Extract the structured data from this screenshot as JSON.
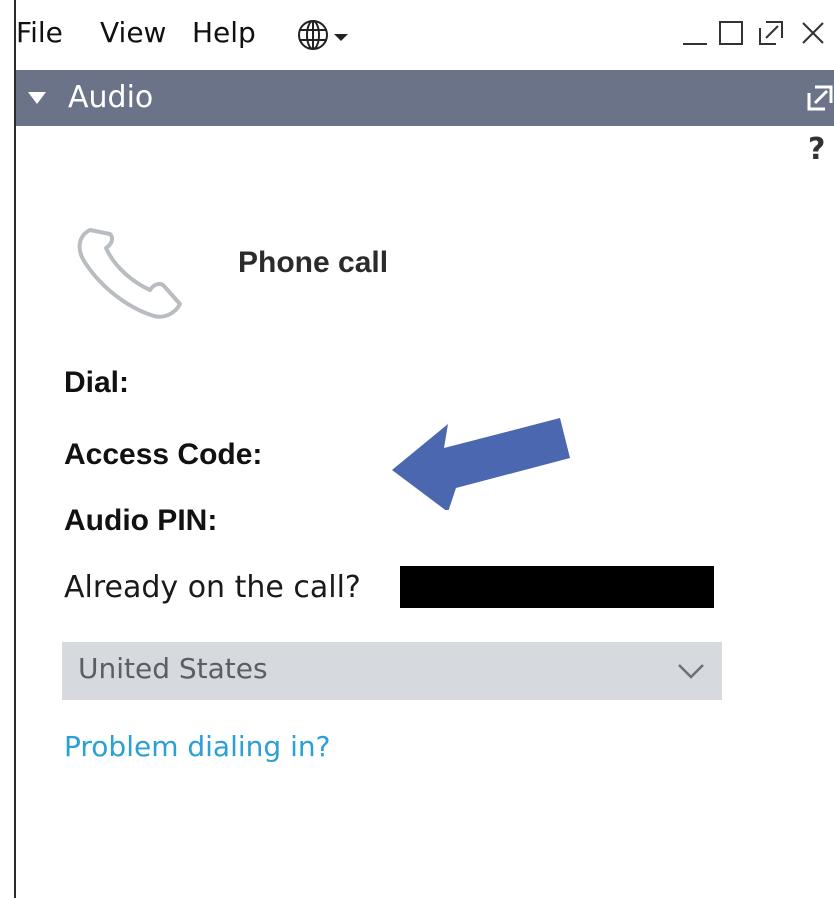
{
  "menu": {
    "file": "File",
    "view": "View",
    "help": "Help",
    "language_icon": "globe-icon"
  },
  "window_controls": [
    "minimize-icon",
    "maximize-icon",
    "popout-icon",
    "close-icon"
  ],
  "panel": {
    "title": "Audio",
    "collapse_icon": "triangle-down-icon",
    "popout_icon": "popout-icon",
    "help": "?"
  },
  "call": {
    "icon": "phone-icon",
    "label": "Phone call",
    "dial_label": "Dial:",
    "access_code_label": "Access Code:",
    "audio_pin_label": "Audio PIN:",
    "already_label": "Already on the call?"
  },
  "country": {
    "selected": "United States"
  },
  "problem_link": "Problem dialing in?",
  "colors": {
    "header_bg": "#6a7387",
    "link": "#2aa0d6",
    "arrow": "#4a67b0",
    "dropdown_bg": "#d6d9dd"
  }
}
